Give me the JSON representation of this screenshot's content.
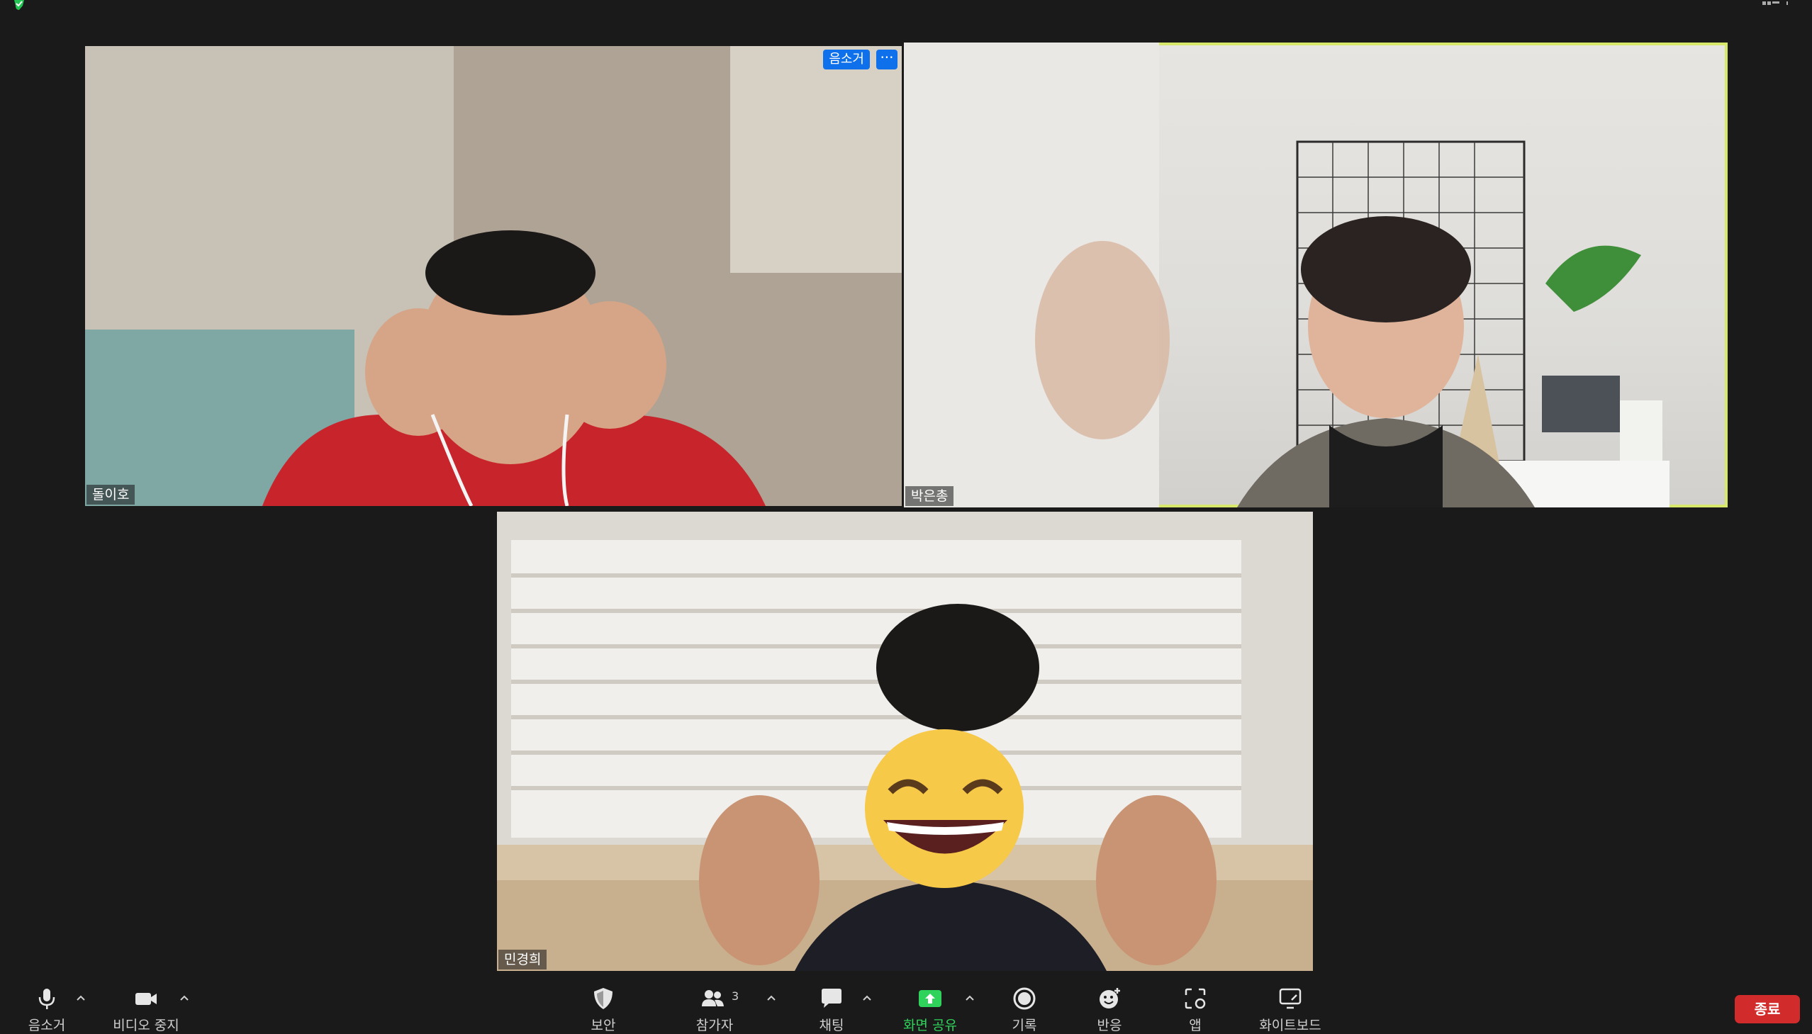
{
  "participants": [
    {
      "name": "돌이호",
      "mute_label": "음소거",
      "more_label": "···"
    },
    {
      "name": "박은총"
    },
    {
      "name": "민경희"
    }
  ],
  "toolbar": {
    "mute_label": "음소거",
    "video_label": "비디오 중지",
    "security_label": "보안",
    "participants_label": "참가자",
    "participants_count": "3",
    "chat_label": "채팅",
    "share_label": "화면 공유",
    "record_label": "기록",
    "reactions_label": "반응",
    "apps_label": "앱",
    "whiteboard_label": "화이트보드",
    "end_label": "종료"
  },
  "colors": {
    "background": "#1a1a1a",
    "active_speaker_border": "#d8e86a",
    "accent_blue": "#0e71eb",
    "share_green": "#2fd25a",
    "end_red": "#d22b2b"
  },
  "icons": [
    "shield-check-icon",
    "gallery-view-icon",
    "microphone-icon",
    "video-camera-icon",
    "security-shield-icon",
    "participants-icon",
    "chat-bubble-icon",
    "share-screen-icon",
    "record-icon",
    "reactions-icon",
    "apps-icon",
    "whiteboard-icon"
  ]
}
